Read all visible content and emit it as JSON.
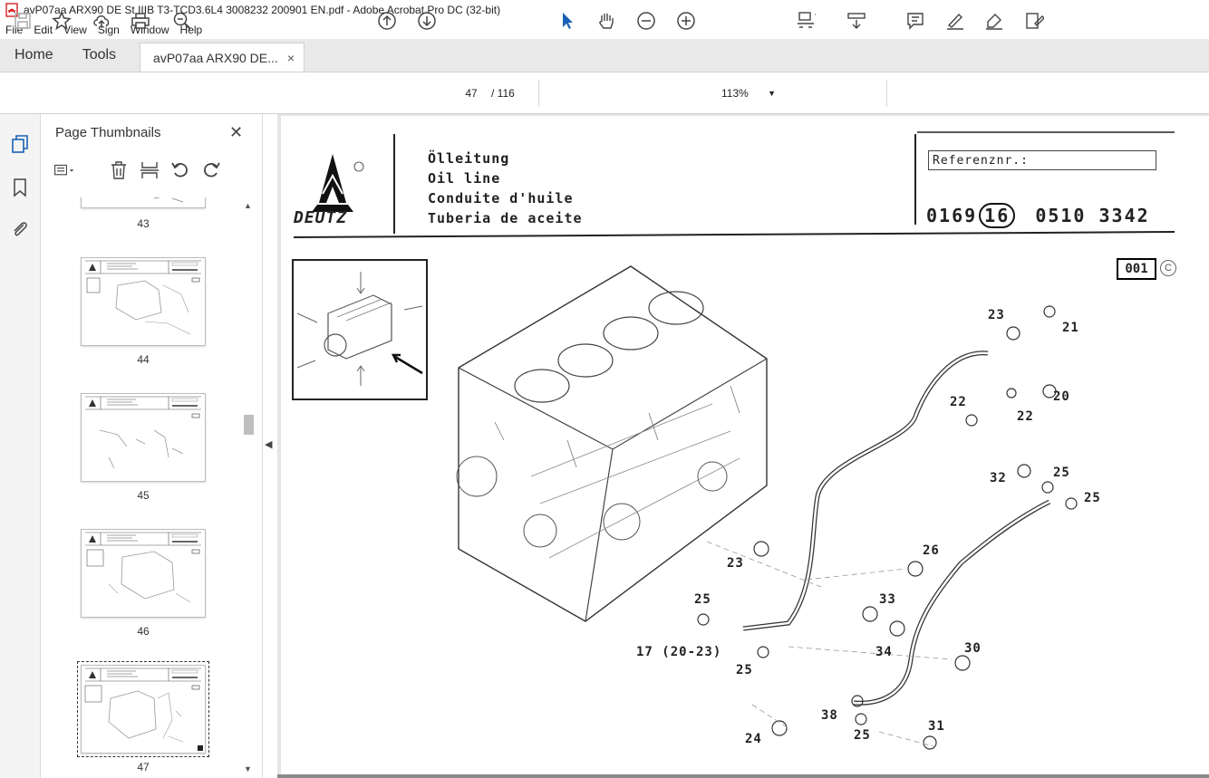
{
  "window": {
    "title": "avP07aa ARX90 DE St IIIB T3-TCD3.6L4 3008232 200901 EN.pdf - Adobe Acrobat Pro DC (32-bit)"
  },
  "menu": [
    "File",
    "Edit",
    "View",
    "Sign",
    "Window",
    "Help"
  ],
  "tabs": {
    "home": "Home",
    "tools": "Tools",
    "document": "avP07aa ARX90 DE...",
    "close": "×"
  },
  "toolbar": {
    "current_page": "47",
    "page_separator": "/ 116",
    "zoom": "113%"
  },
  "panel": {
    "title": "Page Thumbnails",
    "close": "✕",
    "thumbnails": [
      {
        "label": "43"
      },
      {
        "label": "44"
      },
      {
        "label": "45"
      },
      {
        "label": "46"
      },
      {
        "label": "47"
      }
    ]
  },
  "document_page": {
    "brand": "DEUTZ",
    "title_lines": [
      "Ölleitung",
      "Oil line",
      "Conduite d'huile",
      "Tuberia de aceite"
    ],
    "reference_label": "Referenznr.:",
    "reference_number": {
      "part1": "0169",
      "part2": "16",
      "part3": "0510 3342"
    },
    "sheet_badge": "001",
    "copyright": "C",
    "callouts": [
      {
        "text": "23"
      },
      {
        "text": "21"
      },
      {
        "text": "22"
      },
      {
        "text": "22"
      },
      {
        "text": "20"
      },
      {
        "text": "32"
      },
      {
        "text": "25"
      },
      {
        "text": "25"
      },
      {
        "text": "26"
      },
      {
        "text": "23"
      },
      {
        "text": "25"
      },
      {
        "text": "33"
      },
      {
        "text": "17 (20-23)"
      },
      {
        "text": "34"
      },
      {
        "text": "30"
      },
      {
        "text": "25"
      },
      {
        "text": "38"
      },
      {
        "text": "24"
      },
      {
        "text": "25"
      },
      {
        "text": "31"
      }
    ]
  }
}
